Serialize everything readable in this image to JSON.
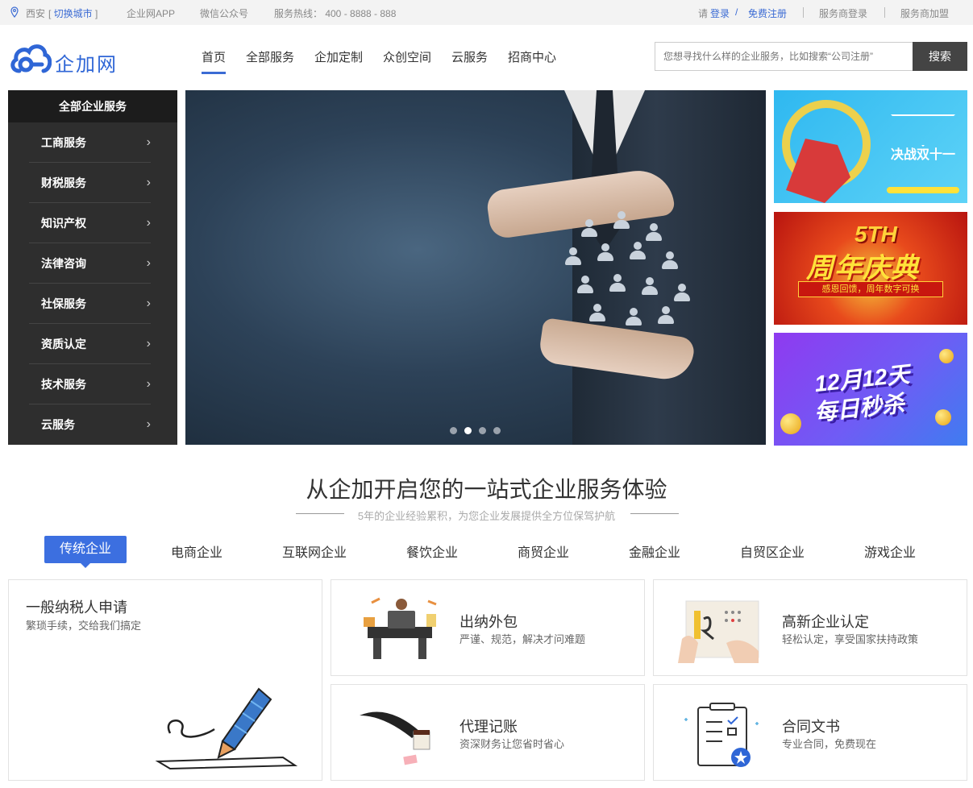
{
  "topbar": {
    "city": "西安",
    "switch_city": "切换城市",
    "app": "企业网APP",
    "wechat": "微信公众号",
    "hotline": "服务热线： 400 - 8888 - 888",
    "login_prefix": "请",
    "login": "登录",
    "slash": "/",
    "register": "免费注册",
    "provider_login": "服务商登录",
    "provider_join": "服务商加盟"
  },
  "header": {
    "logo_text": "企加网",
    "nav": [
      "首页",
      "全部服务",
      "企加定制",
      "众创空间",
      "云服务",
      "招商中心"
    ],
    "search_placeholder": "您想寻找什么样的企业服务，比如搜索“公司注册”",
    "search_button": "搜索"
  },
  "sidebar": {
    "title": "全部企业服务",
    "items": [
      "工商服务",
      "财税服务",
      "知识产权",
      "法律咨询",
      "社保服务",
      "资质认定",
      "技术服务",
      "云服务"
    ]
  },
  "banner": {
    "slides": 4,
    "active": 2
  },
  "promos": {
    "p1_text": "决战双十一",
    "p2_five": "5TH",
    "p2_title": "周年庆典",
    "p2_ribbon": "感恩回馈，周年数字可换",
    "p3_title": "12月12天",
    "p3_sub": "每日秒杀"
  },
  "section": {
    "title": "从企加开启您的一站式企业服务体验",
    "subtitle": "5年的企业经验累积，为您企业发展提供全方位保驾护航"
  },
  "tabs": [
    "传统企业",
    "电商企业",
    "互联网企业",
    "餐饮企业",
    "商贸企业",
    "金融企业",
    "自贸区企业",
    "游戏企业"
  ],
  "cards": [
    {
      "title": "一般纳税人申请",
      "desc": "繁琐手续，交给我们搞定"
    },
    {
      "title": "出纳外包",
      "desc": "严谨、规范，解决才问难题"
    },
    {
      "title": "高新企业认定",
      "desc": "轻松认定，享受国家扶持政策"
    },
    {
      "title": "代理记账",
      "desc": "资深财务让您省时省心"
    },
    {
      "title": "合同文书",
      "desc": "专业合同，免费现在"
    }
  ],
  "colors": {
    "accent": "#3c6fe0",
    "sidebar_bg": "#2e2e2e",
    "sidebar_head": "#1c1c1c"
  }
}
